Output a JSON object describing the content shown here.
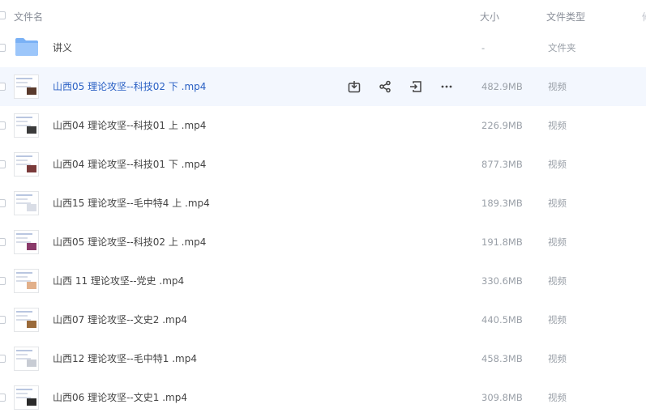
{
  "header": {
    "name_label": "文件名",
    "size_label": "大小",
    "type_label": "文件类型",
    "extra_label": "修"
  },
  "files": [
    {
      "name": "讲义",
      "size": "-",
      "type": "文件夹",
      "icon": "folder-icon",
      "thumb_color": ""
    },
    {
      "name": "山西05 理论攻坚--科技02 下 .mp4",
      "size": "482.9MB",
      "type": "视频",
      "icon": "video-thumbnail",
      "thumb_color": "#5a3a2c",
      "hover": true
    },
    {
      "name": "山西04 理论攻坚--科技01 上 .mp4",
      "size": "226.9MB",
      "type": "视频",
      "icon": "video-thumbnail",
      "thumb_color": "#3b3b3b"
    },
    {
      "name": "山西04 理论攻坚--科技01 下 .mp4",
      "size": "877.3MB",
      "type": "视频",
      "icon": "video-thumbnail",
      "thumb_color": "#7a3a3a"
    },
    {
      "name": "山西15 理论攻坚--毛中特4 上 .mp4",
      "size": "189.3MB",
      "type": "视频",
      "icon": "video-thumbnail",
      "thumb_color": "#d9dde6"
    },
    {
      "name": "山西05 理论攻坚--科技02 上 .mp4",
      "size": "191.8MB",
      "type": "视频",
      "icon": "video-thumbnail",
      "thumb_color": "#8a3a6a"
    },
    {
      "name": "山西 11 理论攻坚--党史 .mp4",
      "size": "330.6MB",
      "type": "视频",
      "icon": "video-thumbnail",
      "thumb_color": "#e2b08a"
    },
    {
      "name": "山西07 理论攻坚--文史2 .mp4",
      "size": "440.5MB",
      "type": "视频",
      "icon": "video-thumbnail",
      "thumb_color": "#9a6a3a"
    },
    {
      "name": "山西12 理论攻坚--毛中特1 .mp4",
      "size": "458.3MB",
      "type": "视频",
      "icon": "video-thumbnail",
      "thumb_color": "#c8ccd4"
    },
    {
      "name": "山西06 理论攻坚--文史1 .mp4",
      "size": "309.8MB",
      "type": "视频",
      "icon": "video-thumbnail",
      "thumb_color": "#2a2a2a"
    }
  ],
  "row_actions": [
    {
      "icon": "download-icon"
    },
    {
      "icon": "share-icon"
    },
    {
      "icon": "move-icon"
    },
    {
      "icon": "more-icon"
    }
  ]
}
